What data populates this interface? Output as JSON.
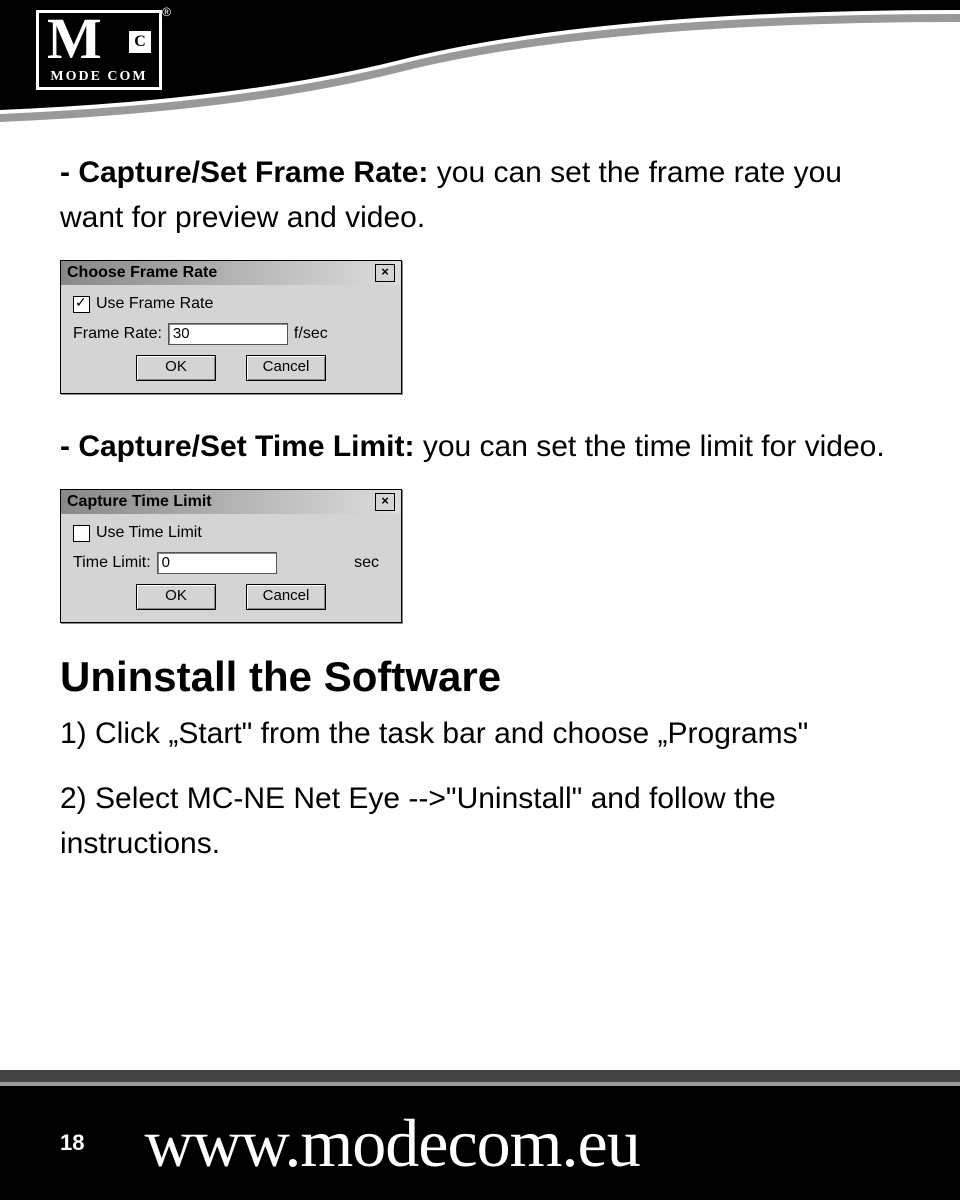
{
  "logo": {
    "brand": "MODE COM",
    "trademark": "®"
  },
  "section1": {
    "label_bold": "- Capture/Set Frame Rate:",
    "label_rest": " you can set the frame rate you want for preview and video."
  },
  "dialog1": {
    "title": "Choose Frame Rate",
    "checkbox_label": "Use Frame Rate",
    "field_label": "Frame Rate:",
    "field_value": "30",
    "unit": "f/sec",
    "ok": "OK",
    "cancel": "Cancel"
  },
  "section2": {
    "label_bold": "- Capture/Set Time Limit:",
    "label_rest": " you can set the time limit for video."
  },
  "dialog2": {
    "title": "Capture Time Limit",
    "checkbox_label": "Use Time Limit",
    "field_label": "Time Limit:",
    "field_value": "0",
    "unit": "sec",
    "ok": "OK",
    "cancel": "Cancel"
  },
  "uninstall": {
    "heading": "Uninstall the Software",
    "step1": "1) Click „Start\" from the task bar and choose „Programs\"",
    "step2": "2) Select MC-NE Net Eye -->\"Uninstall\" and follow the instructions."
  },
  "footer": {
    "page": "18",
    "url": "www.modecom.eu"
  }
}
